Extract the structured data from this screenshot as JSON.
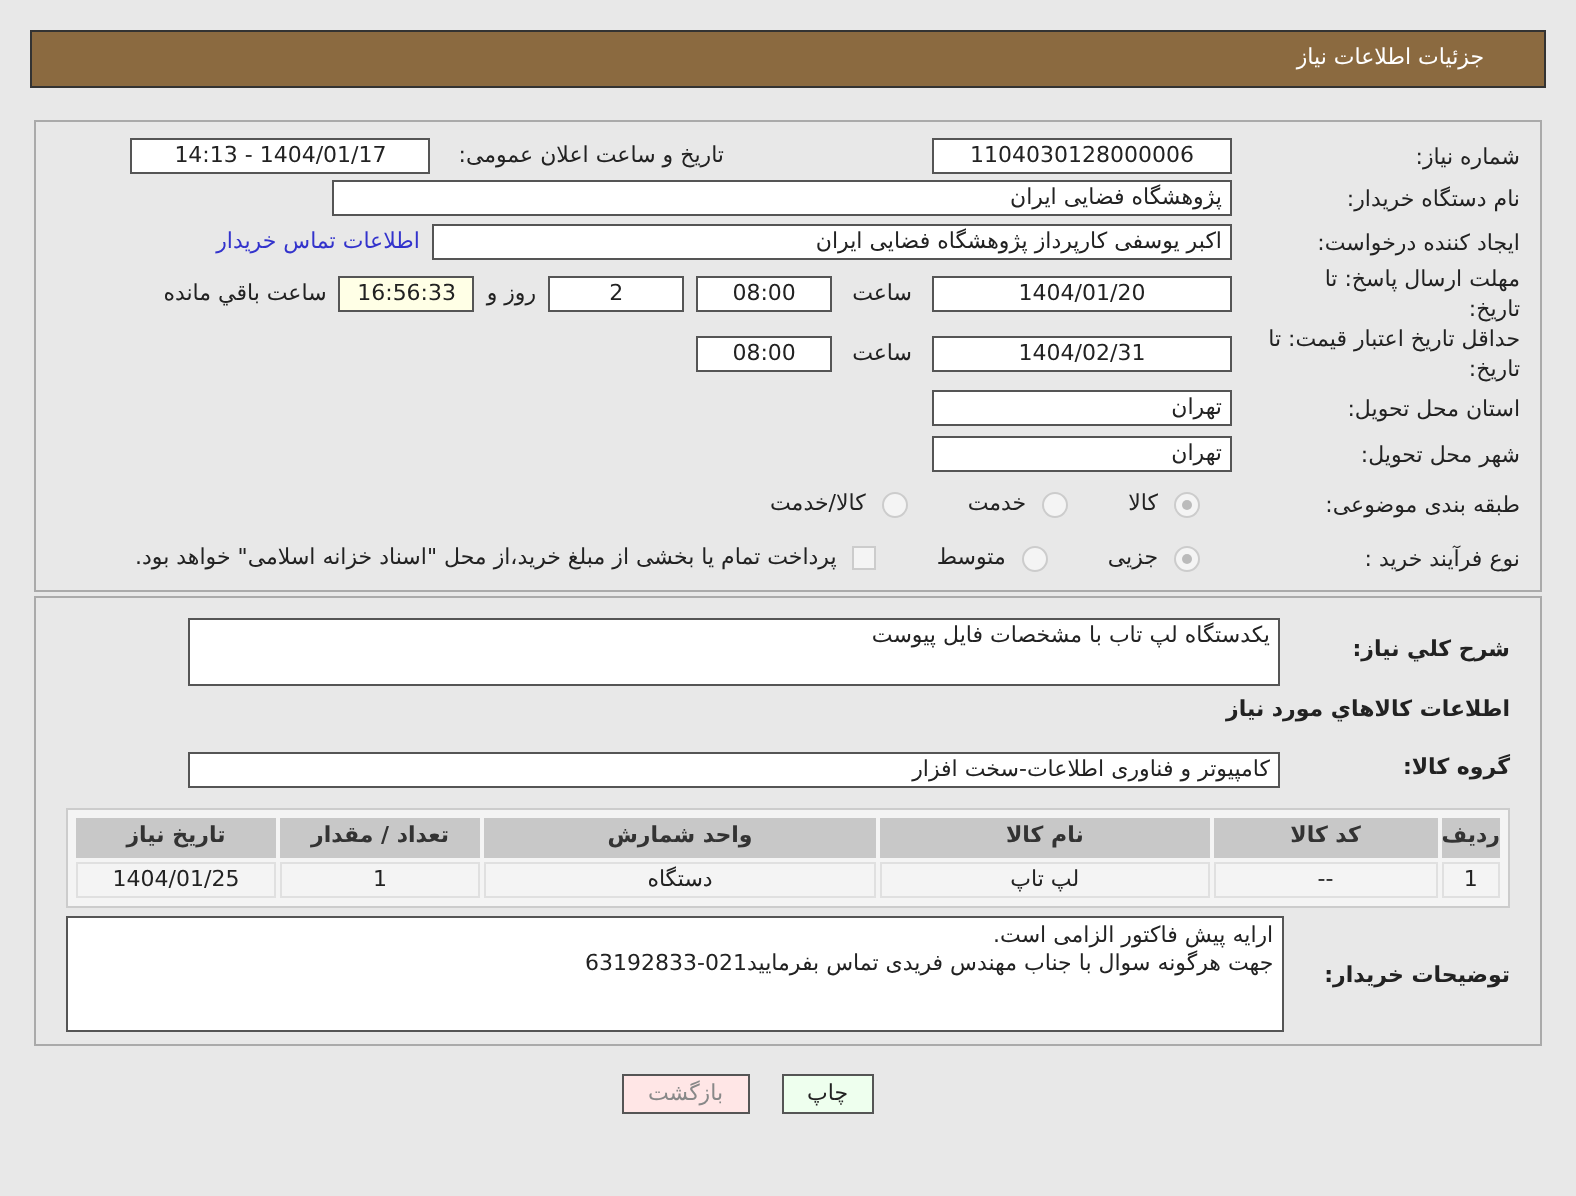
{
  "header": {
    "title": "جزئیات اطلاعات نیاز"
  },
  "need_number": {
    "label": "شماره نیاز:",
    "value": "1104030128000006"
  },
  "announce": {
    "label": "تاریخ و ساعت اعلان عمومی:",
    "value": "1404/01/17 - 14:13"
  },
  "buyer": {
    "label": "نام دستگاه خریدار:",
    "value": "پژوهشگاه فضایی ایران"
  },
  "creator": {
    "label": "ایجاد کننده درخواست:",
    "value": "اکبر یوسفی کارپرداز پژوهشگاه فضایی ایران",
    "link": "اطلاعات تماس خریدار"
  },
  "deadline": {
    "label": "مهلت ارسال پاسخ: تا تاریخ:",
    "date": "1404/01/20",
    "time_label": "ساعت",
    "time": "08:00",
    "days": "2",
    "days_label": "روز و",
    "remaining": "16:56:33",
    "remaining_label": "ساعت باقي مانده"
  },
  "validity": {
    "label": "حداقل تاریخ اعتبار قیمت: تا تاریخ:",
    "date": "1404/02/31",
    "time_label": "ساعت",
    "time": "08:00"
  },
  "province": {
    "label": "استان محل تحویل:",
    "value": "تهران"
  },
  "city": {
    "label": "شهر محل تحویل:",
    "value": "تهران"
  },
  "category": {
    "label": "طبقه بندی موضوعی:",
    "options": [
      {
        "label": "کالا",
        "selected": true
      },
      {
        "label": "خدمت",
        "selected": false
      },
      {
        "label": "کالا/خدمت",
        "selected": false
      }
    ]
  },
  "process": {
    "label": "نوع فرآیند خرید :",
    "options": [
      {
        "label": "جزیی",
        "selected": true
      },
      {
        "label": "متوسط",
        "selected": false
      }
    ],
    "treasury": {
      "label": "پرداخت تمام یا بخشی از مبلغ خرید،از محل \"اسناد خزانه اسلامی\" خواهد بود.",
      "checked": false
    }
  },
  "description": {
    "label": "شرح کلي نياز:",
    "value": "یکدستگاه لپ تاب با مشخصات فایل پیوست"
  },
  "goods_heading": "اطلاعات كالاهاي مورد نياز",
  "goods_group": {
    "label": "گروه کالا:",
    "value": "کامپیوتر و فناوری اطلاعات-سخت افزار"
  },
  "table": {
    "columns": [
      "ردیف",
      "کد کالا",
      "نام کالا",
      "واحد شمارش",
      "تعداد / مقدار",
      "تاریخ نیاز"
    ],
    "rows": [
      [
        "1",
        "--",
        "لپ تاپ",
        "دستگاه",
        "1",
        "1404/01/25"
      ]
    ]
  },
  "buyer_notes": {
    "label": "توضیحات خریدار:",
    "lines": [
      "ارایه پیش فاکتور الزامی است.",
      "جهت هرگونه سوال با جناب مهندس فریدی تماس بفرمایید021-63192833"
    ]
  },
  "buttons": [
    {
      "label": "چاپ",
      "kind": "print"
    },
    {
      "label": "بازگشت",
      "kind": "back"
    }
  ]
}
